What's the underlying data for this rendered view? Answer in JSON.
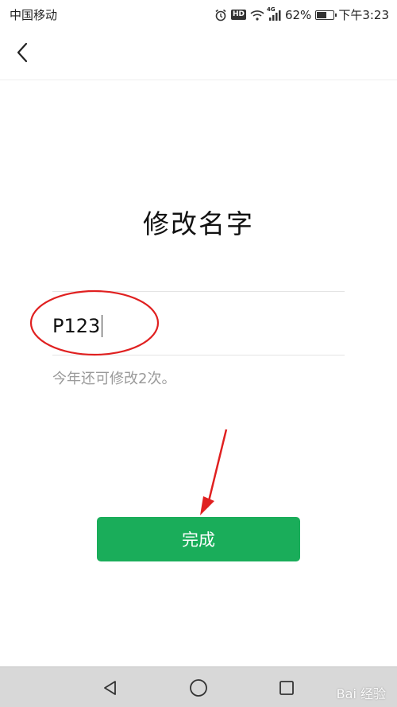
{
  "status_bar": {
    "carrier": "中国移动",
    "network": "4G",
    "battery": "62%",
    "battery_level": 0.62,
    "time": "下午3:23"
  },
  "nav": {
    "back_icon": "chevron-left-icon"
  },
  "page": {
    "title": "修改名字",
    "name_value": "P123",
    "hint": "今年还可修改2次。",
    "done_label": "完成"
  },
  "system_nav": {
    "back_icon": "triangle-back-icon",
    "home_icon": "circle-home-icon",
    "recents_icon": "square-recents-icon"
  },
  "watermark": "Bai 经验",
  "colors": {
    "primary_green": "#1aad5a",
    "annotation_red": "#e02020",
    "hint_gray": "#9a9a9a"
  }
}
